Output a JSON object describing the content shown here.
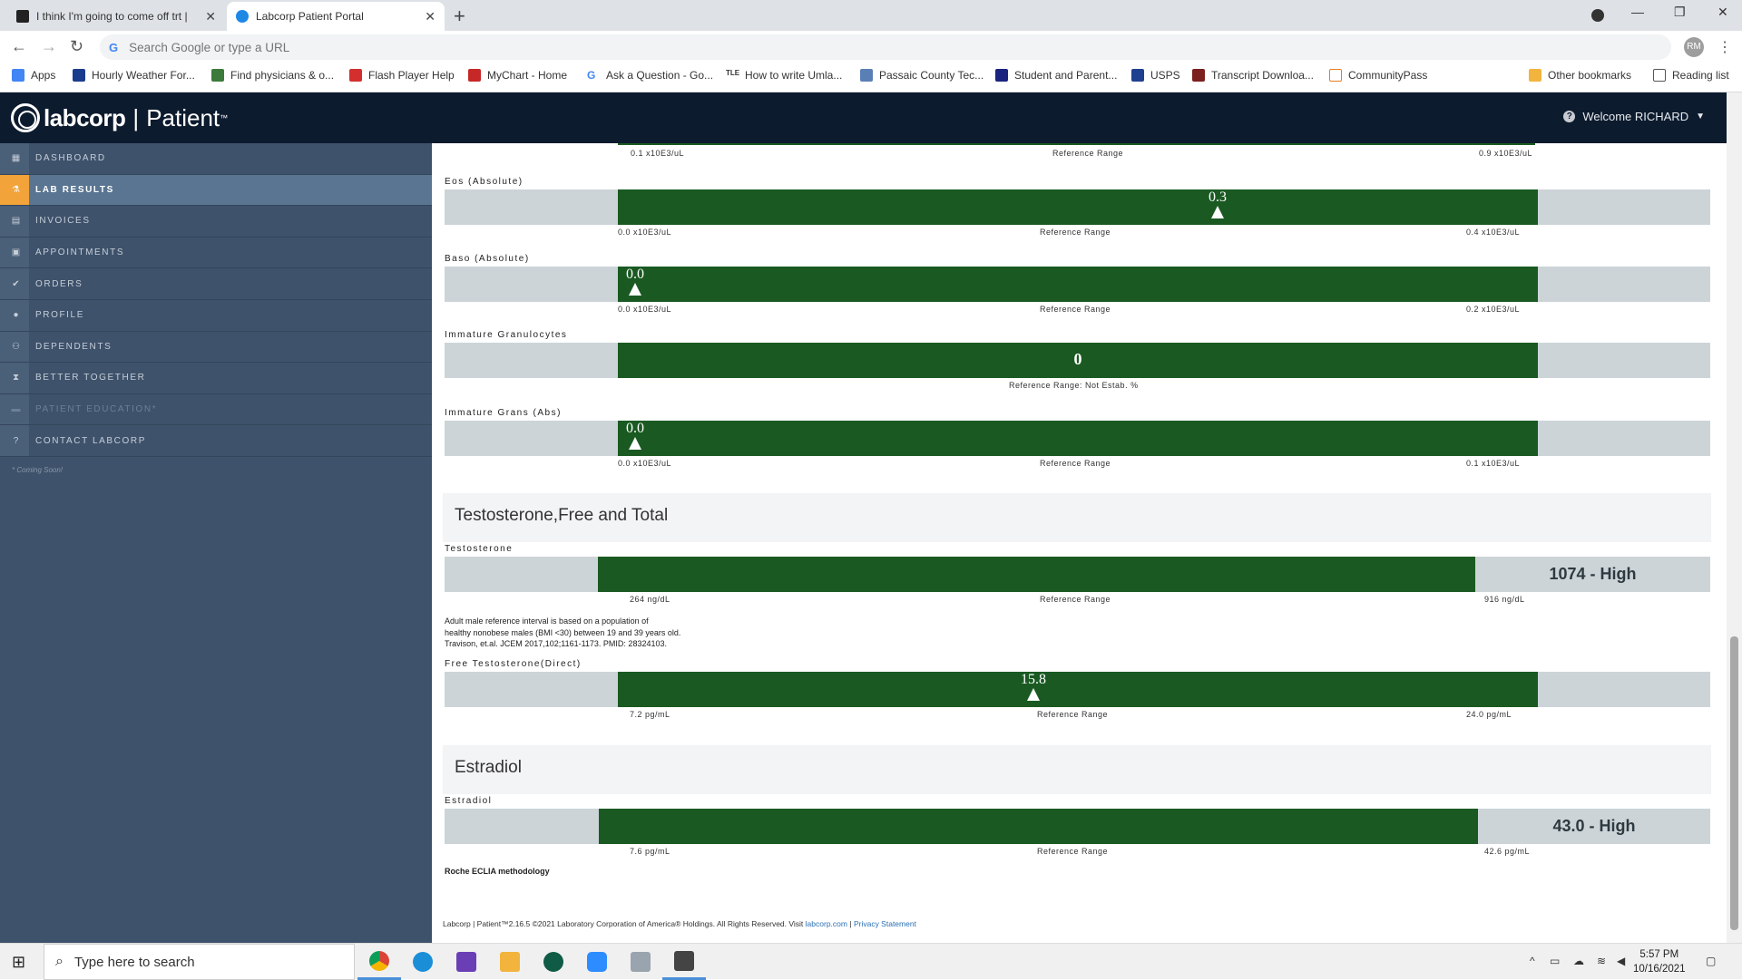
{
  "browser": {
    "tabs": [
      {
        "label": "I think I'm going to come off trt |",
        "active": false
      },
      {
        "label": "Labcorp Patient Portal",
        "active": true
      }
    ],
    "omnibox_placeholder": "Search Google or type a URL",
    "profile_initials": "RM",
    "bookmarks": [
      "Apps",
      "Hourly Weather For...",
      "Find physicians & o...",
      "Flash Player Help",
      "MyChart - Home",
      "Ask a Question - Go...",
      "How to write Umla...",
      "Passaic County Tec...",
      "Student and Parent...",
      "USPS",
      "Transcript Downloa...",
      "CommunityPass"
    ],
    "other_bookmarks": "Other bookmarks",
    "reading_list": "Reading list"
  },
  "header": {
    "brand": "labcorp",
    "product": "Patient",
    "tm": "™",
    "welcome": "Welcome RICHARD"
  },
  "sidebar": {
    "items": [
      {
        "label": "DASHBOARD",
        "icon": "grid-icon"
      },
      {
        "label": "LAB RESULTS",
        "icon": "flask-icon",
        "active": true
      },
      {
        "label": "INVOICES",
        "icon": "invoice-icon"
      },
      {
        "label": "APPOINTMENTS",
        "icon": "calendar-icon"
      },
      {
        "label": "ORDERS",
        "icon": "check-icon"
      },
      {
        "label": "PROFILE",
        "icon": "person-icon"
      },
      {
        "label": "DEPENDENTS",
        "icon": "people-icon"
      },
      {
        "label": "BETTER TOGETHER",
        "icon": "hourglass-icon"
      },
      {
        "label": "PATIENT EDUCATION*",
        "icon": "cap-icon",
        "disabled": true
      },
      {
        "label": "CONTACT LABCORP",
        "icon": "help-icon"
      }
    ],
    "coming_soon": "* Coming Soon!"
  },
  "results": {
    "top_ticks": {
      "low": "0.1 x10E3/uL",
      "mid": "Reference Range",
      "high": "0.9 x10E3/uL"
    },
    "eos": {
      "name": "Eos (Absolute)",
      "value": "0.3",
      "value_num": 0.3,
      "low": "0.0 x10E3/uL",
      "mid": "Reference Range",
      "high": "0.4 x10E3/uL",
      "range": [
        0.0,
        0.4
      ]
    },
    "baso": {
      "name": "Baso (Absolute)",
      "value": "0.0",
      "value_num": 0.0,
      "low": "0.0 x10E3/uL",
      "mid": "Reference Range",
      "high": "0.2 x10E3/uL",
      "range": [
        0.0,
        0.2
      ]
    },
    "immgran": {
      "name": "Immature Granulocytes",
      "value": "0",
      "mid": "Reference Range:  Not Estab. %"
    },
    "immgranabs": {
      "name": "Immature Grans (Abs)",
      "value": "0.0",
      "value_num": 0.0,
      "low": "0.0 x10E3/uL",
      "mid": "Reference Range",
      "high": "0.1 x10E3/uL",
      "range": [
        0.0,
        0.1
      ]
    },
    "testo_section": "Testosterone,Free and Total",
    "testo": {
      "name": "Testosterone",
      "value": "1074 - High",
      "low": "264 ng/dL",
      "mid": "Reference Range",
      "high": "916 ng/dL"
    },
    "testo_note": [
      "Adult male reference interval is based on a population of",
      "healthy nonobese males (BMI <30) between 19 and 39 years old.",
      "Travison, et.al. JCEM 2017,102;1161-1173. PMID: 28324103."
    ],
    "freetesto": {
      "name": "Free Testosterone(Direct)",
      "value": "15.8",
      "value_num": 15.8,
      "low": "7.2 pg/mL",
      "mid": "Reference Range",
      "high": "24.0 pg/mL",
      "range": [
        7.2,
        24.0
      ]
    },
    "estra_section": "Estradiol",
    "estra": {
      "name": "Estradiol",
      "value": "43.0 - High",
      "low": "7.6 pg/mL",
      "mid": "Reference Range",
      "high": "42.6 pg/mL"
    },
    "estra_note": "Roche ECLIA methodology"
  },
  "footer": {
    "text": "Labcorp | Patient™2.16.5 ©2021 Laboratory Corporation of America® Holdings. All Rights Reserved. Visit",
    "link1": "labcorp.com",
    "sep": "|",
    "link2": "Privacy Statement"
  },
  "taskbar": {
    "search_placeholder": "Type here to search",
    "time": "5:57 PM",
    "date": "10/16/2021"
  }
}
